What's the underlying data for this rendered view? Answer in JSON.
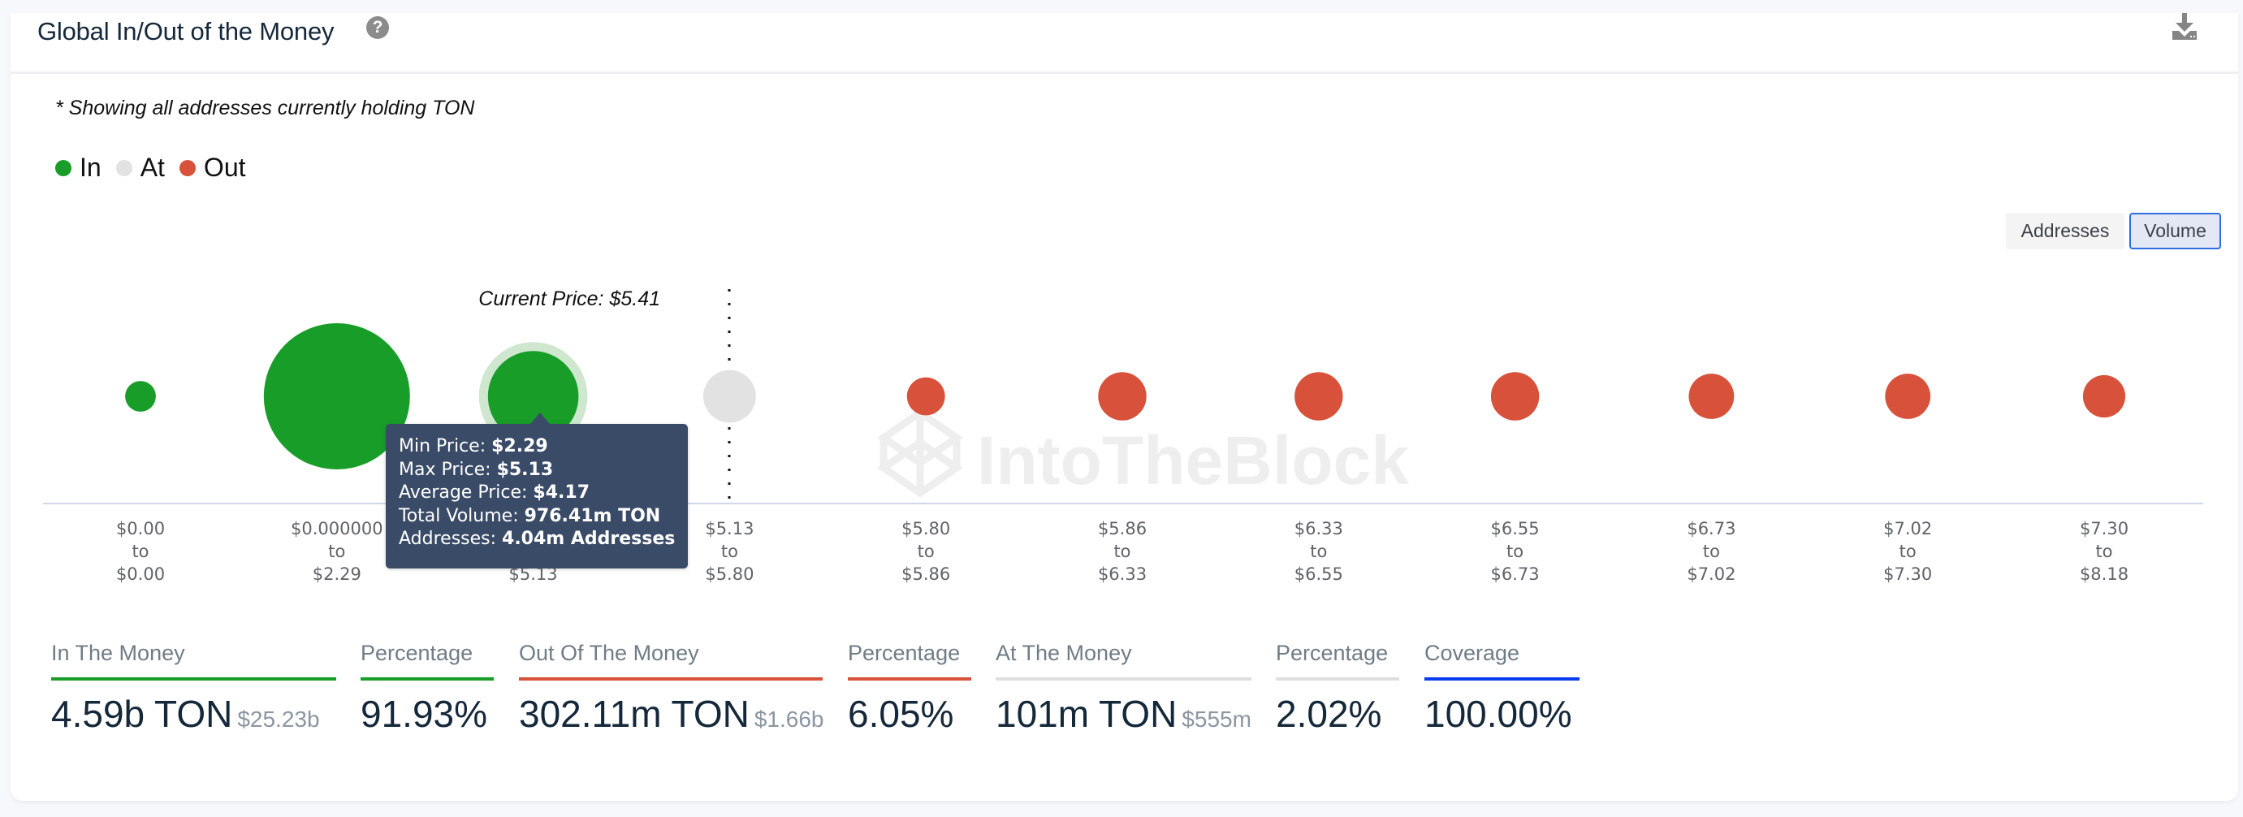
{
  "header": {
    "title": "Global In/Out of the Money",
    "help_icon": "question-circle-icon",
    "download_icon": "download-icon"
  },
  "note": "* Showing all addresses currently holding TON",
  "legend": [
    {
      "label": "In",
      "color": "#189e28"
    },
    {
      "label": "At",
      "color": "#e2e2e2"
    },
    {
      "label": "Out",
      "color": "#d8513a"
    }
  ],
  "toggle": {
    "options": [
      "Addresses",
      "Volume"
    ],
    "selected": "Volume"
  },
  "watermark": "IntoTheBlock",
  "colors": {
    "in": "#189e28",
    "at": "#e2e2e2",
    "out": "#d8513a",
    "coverage": "#0a3cf0",
    "axis": "#cfd8ea"
  },
  "chart_data": {
    "type": "bubble",
    "title": "Global In/Out of the Money",
    "current_price_label": "Current Price: $5.41",
    "current_price": 5.41,
    "measure": "Volume",
    "categories": [
      {
        "from": "$0.00",
        "to": "$0.00",
        "status": "in",
        "relative_size": 0.21
      },
      {
        "from": "$0.000000",
        "to": "$2.29",
        "status": "in",
        "relative_size": 1.0
      },
      {
        "from": "$2.29",
        "to": "$5.13",
        "status": "in",
        "relative_size": 0.62,
        "highlighted": true
      },
      {
        "from": "$5.13",
        "to": "$5.80",
        "status": "at",
        "relative_size": 0.36
      },
      {
        "from": "$5.80",
        "to": "$5.86",
        "status": "out",
        "relative_size": 0.26
      },
      {
        "from": "$5.86",
        "to": "$6.33",
        "status": "out",
        "relative_size": 0.33
      },
      {
        "from": "$6.33",
        "to": "$6.55",
        "status": "out",
        "relative_size": 0.33
      },
      {
        "from": "$6.55",
        "to": "$6.73",
        "status": "out",
        "relative_size": 0.33
      },
      {
        "from": "$6.73",
        "to": "$7.02",
        "status": "out",
        "relative_size": 0.31
      },
      {
        "from": "$7.02",
        "to": "$7.30",
        "status": "out",
        "relative_size": 0.31
      },
      {
        "from": "$7.30",
        "to": "$8.18",
        "status": "out",
        "relative_size": 0.29
      }
    ],
    "to_word": "to",
    "tooltip": {
      "rows": [
        {
          "label": "Min Price: ",
          "value": "$2.29"
        },
        {
          "label": "Max Price: ",
          "value": "$5.13"
        },
        {
          "label": "Average Price: ",
          "value": "$4.17"
        },
        {
          "label": "Total Volume: ",
          "value": "976.41m TON"
        },
        {
          "label": "Addresses: ",
          "value": "4.04m Addresses"
        }
      ]
    }
  },
  "stats": [
    {
      "label": "In The Money",
      "value": "4.59b TON",
      "sub": "$25.23b",
      "color": "#189e28"
    },
    {
      "label": "Percentage",
      "value": "91.93%",
      "sub": "",
      "color": "#189e28"
    },
    {
      "label": "Out Of The Money",
      "value": "302.11m TON",
      "sub": "$1.66b",
      "color": "#d8513a"
    },
    {
      "label": "Percentage",
      "value": "6.05%",
      "sub": "",
      "color": "#d8513a"
    },
    {
      "label": "At The Money",
      "value": "101m TON",
      "sub": "$555m",
      "color": "#dedede"
    },
    {
      "label": "Percentage",
      "value": "2.02%",
      "sub": "",
      "color": "#dedede"
    },
    {
      "label": "Coverage",
      "value": "100.00%",
      "sub": "",
      "color": "#0a3cf0"
    }
  ]
}
